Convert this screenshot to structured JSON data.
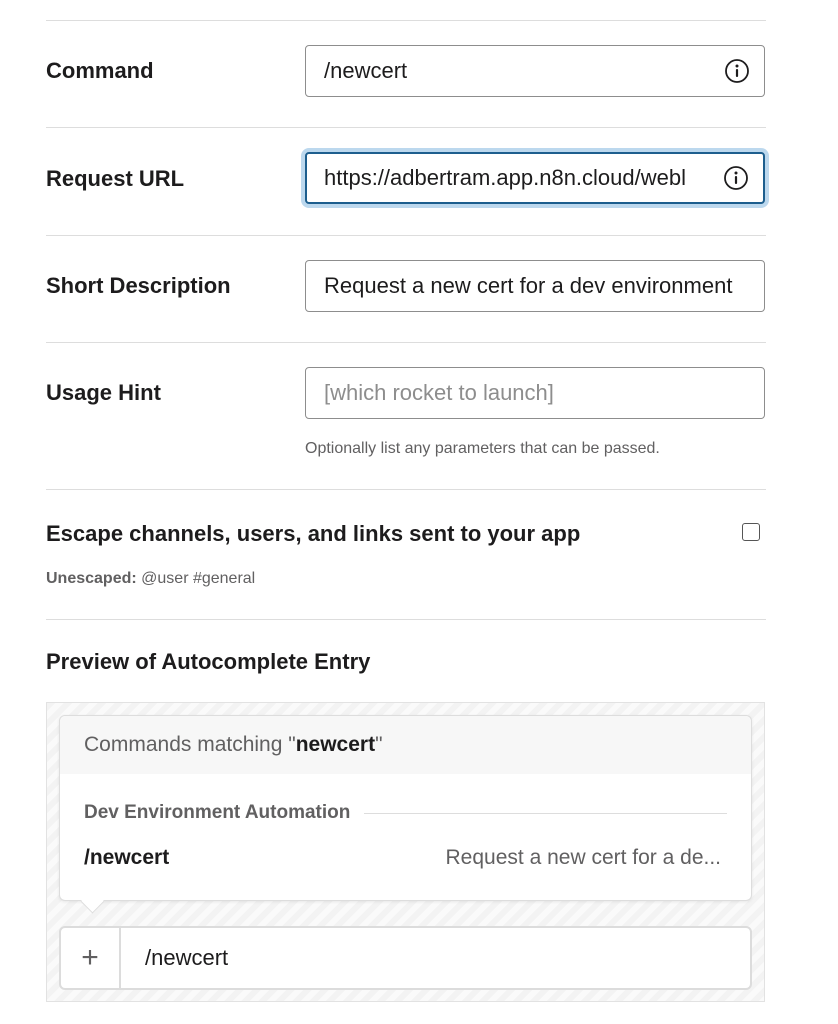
{
  "command": {
    "label": "Command",
    "value": "/newcert",
    "info_icon": "info-circle-icon"
  },
  "request_url": {
    "label": "Request URL",
    "value": "https://adbertram.app.n8n.cloud/webl",
    "info_icon": "info-circle-icon"
  },
  "short_description": {
    "label": "Short Description",
    "value": "Request a new cert for a dev environment"
  },
  "usage_hint": {
    "label": "Usage Hint",
    "placeholder": "[which rocket to launch]",
    "help": "Optionally list any parameters that can be passed."
  },
  "escape": {
    "label": "Escape channels, users, and links sent to your app",
    "checked": false,
    "unescaped_label": "Unescaped:",
    "unescaped_value": " @user #general"
  },
  "preview": {
    "title": "Preview of Autocomplete Entry",
    "header_prefix": "Commands matching \"",
    "header_term": "newcert",
    "header_suffix": "\"",
    "app_name": "Dev Environment Automation",
    "command": "/newcert",
    "description": "Request a new cert for a de...",
    "composer_plus": "+",
    "composer_text": "/newcert"
  },
  "colors": {
    "focus_border": "#1d5e8e",
    "focus_ring": "#bcd8ee",
    "text": "#1d1c1d",
    "muted": "#616061"
  }
}
